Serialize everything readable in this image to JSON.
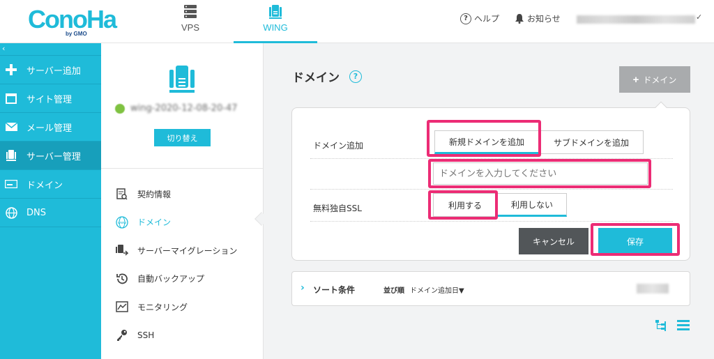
{
  "header": {
    "logo_text": "ConoHa",
    "logo_sub": "by GMO",
    "tabs": [
      {
        "label": "VPS"
      },
      {
        "label": "WING"
      }
    ],
    "help_label": "ヘルプ",
    "notice_label": "お知らせ",
    "user_caret": "✓"
  },
  "sidebar": {
    "collapse": "‹",
    "items": [
      {
        "label": "サーバー追加",
        "icon": "plus-icon"
      },
      {
        "label": "サイト管理",
        "icon": "window-icon"
      },
      {
        "label": "メール管理",
        "icon": "mail-icon"
      },
      {
        "label": "サーバー管理",
        "icon": "server-icon",
        "active": true
      },
      {
        "label": "ドメイン",
        "icon": "domain-icon"
      },
      {
        "label": "DNS",
        "icon": "globe-icon"
      }
    ]
  },
  "subnav": {
    "server_name": "wing-2020-12-08-20-47",
    "switch_label": "切り替え",
    "items": [
      {
        "label": "契約情報"
      },
      {
        "label": "ドメイン"
      },
      {
        "label": "サーバーマイグレーション"
      },
      {
        "label": "自動バックアップ"
      },
      {
        "label": "モニタリング"
      },
      {
        "label": "SSH"
      }
    ]
  },
  "main": {
    "title": "ドメイン",
    "help": "?",
    "add_button": "ドメイン",
    "form": {
      "domain_add_label": "ドメイン追加",
      "new_domain_option": "新規ドメインを追加",
      "sub_domain_option": "サブドメインを追加",
      "domain_placeholder": "ドメインを入力してください",
      "ssl_label": "無料独自SSL",
      "ssl_use": "利用する",
      "ssl_no_use": "利用しない",
      "cancel": "キャンセル",
      "save": "保存"
    },
    "sort": {
      "title": "ソート条件",
      "order_label": "並び順",
      "order_value": "ドメイン追加日▼"
    }
  },
  "colors": {
    "accent": "#1fbbd9",
    "highlight": "#ec2c75",
    "cancel": "#525659",
    "add_button": "#a9abad"
  }
}
